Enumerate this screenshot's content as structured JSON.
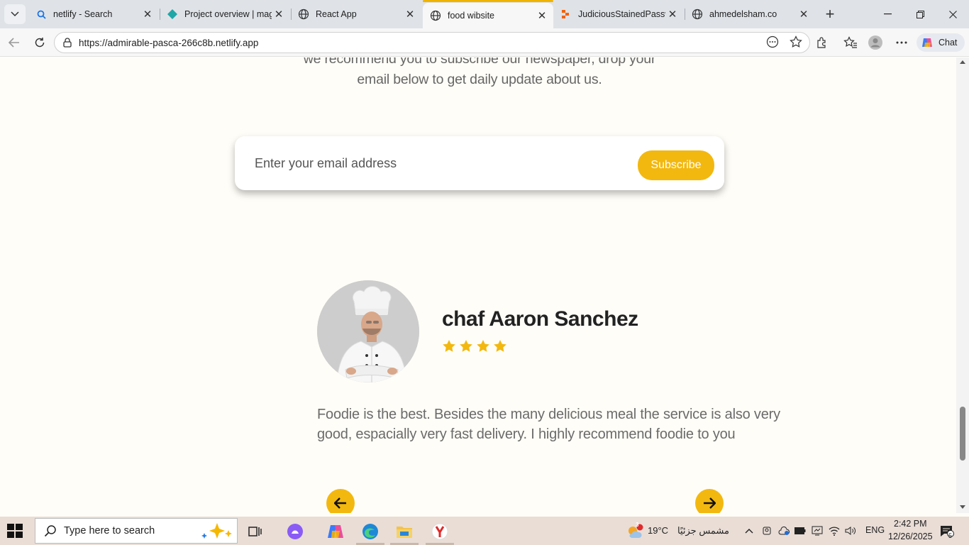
{
  "browser": {
    "tabs": [
      {
        "title": "netlify - Search",
        "icon": "search-icon",
        "active": false
      },
      {
        "title": "Project overview | magen",
        "icon": "netlify-diamond-icon",
        "active": false
      },
      {
        "title": "React App",
        "icon": "globe-icon",
        "active": false
      },
      {
        "title": "food wibsite",
        "icon": "globe-icon",
        "active": true
      },
      {
        "title": "JudiciousStainedPassword",
        "icon": "replit-icon",
        "active": false
      },
      {
        "title": "ahmedelsham.co",
        "icon": "globe-icon",
        "active": false
      }
    ],
    "url": "https://admirable-pasca-266c8b.netlify.app",
    "chat_label": "Chat",
    "accent_color": "#f0b400"
  },
  "page": {
    "newsletter_text": "we recommend you to subscribe our newspaper, drop your email below to get daily update about us.",
    "email_placeholder": "Enter your email address",
    "subscribe_label": "Subscribe",
    "chef_name": "chaf Aaron Sanchez",
    "rating_stars": 4,
    "review_text": "Foodie is the best. Besides the many delicious meal the service is also very good, espacially very fast delivery. I highly recommend foodie to you",
    "button_color": "#f3b80f",
    "page_background": "#fffdf7"
  },
  "taskbar": {
    "search_placeholder": "Type here to search",
    "weather_temp": "19°C",
    "weather_desc": "مشمس جزئيًا",
    "weather_badge": "3",
    "language": "ENG",
    "time": "2:42 PM",
    "date": "12/26/2025",
    "notification_count": "5"
  }
}
